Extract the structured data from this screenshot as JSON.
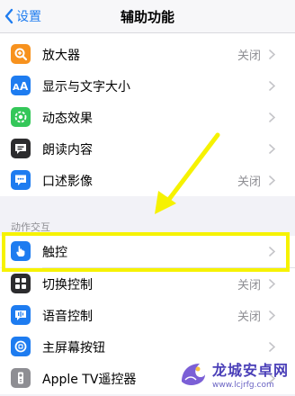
{
  "nav": {
    "back_label": "设置",
    "title": "辅助功能"
  },
  "rows_top": [
    {
      "label": "放大器",
      "value": "关闭",
      "icon": "magnifier-icon",
      "color": "#f7921e"
    },
    {
      "label": "显示与文字大小",
      "value": "",
      "icon": "text-size-icon",
      "color": "#1e7cf0"
    },
    {
      "label": "动态效果",
      "value": "",
      "icon": "motion-icon",
      "color": "#34c759"
    },
    {
      "label": "朗读内容",
      "value": "",
      "icon": "speech-icon",
      "color": "#2c2c2e"
    },
    {
      "label": "口述影像",
      "value": "关闭",
      "icon": "audio-description-icon",
      "color": "#1e7cf0"
    }
  ],
  "section_header": "动作交互",
  "rows_bottom": [
    {
      "label": "触控",
      "value": "",
      "icon": "touch-hand-icon",
      "color": "#1e7cf0"
    },
    {
      "label": "切换控制",
      "value": "关闭",
      "icon": "switch-control-icon",
      "color": "#2c2c2e"
    },
    {
      "label": "语音控制",
      "value": "关闭",
      "icon": "voice-control-icon",
      "color": "#1e7cf0"
    },
    {
      "label": "主屏幕按钮",
      "value": "",
      "icon": "home-button-icon",
      "color": "#1e7cf0"
    },
    {
      "label": "Apple TV遥控器",
      "value": "",
      "icon": "tv-remote-icon",
      "color": "#8e8e93"
    }
  ],
  "watermark": {
    "main": "龙城安卓网",
    "sub": "www.lcjrfg.com"
  },
  "accent_color": "#1e7cf0",
  "highlight_color": "#f6f200"
}
